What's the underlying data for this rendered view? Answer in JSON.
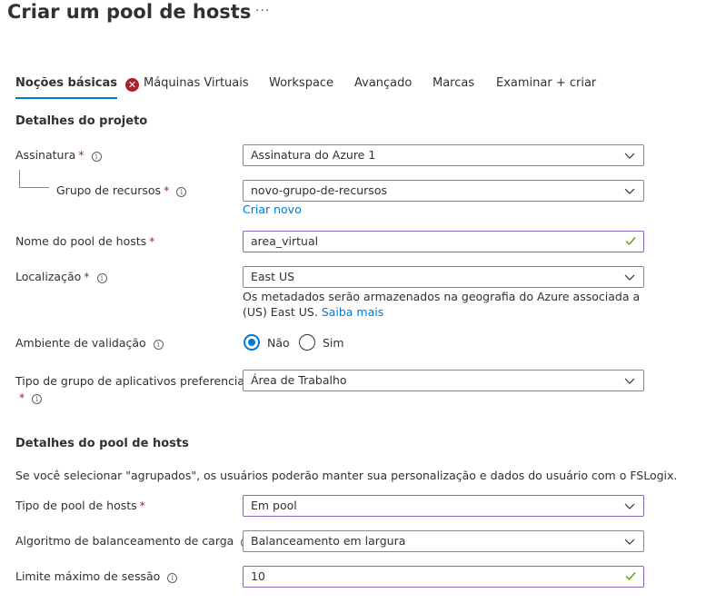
{
  "page": {
    "title": "Criar um pool de hosts",
    "more": "···"
  },
  "tabs": [
    {
      "label": "Noções básicas",
      "active": true
    },
    {
      "label": "Máquinas Virtuais",
      "error": true
    },
    {
      "label": "Workspace"
    },
    {
      "label": "Avançado"
    },
    {
      "label": "Marcas"
    },
    {
      "label": "Examinar + criar"
    }
  ],
  "project": {
    "heading": "Detalhes do projeto",
    "subscription": {
      "label": "Assinatura",
      "required": "*",
      "value": "Assinatura do Azure 1"
    },
    "resource_group": {
      "label": "Grupo de recursos",
      "required": "*",
      "value": "novo-grupo-de-recursos",
      "create_new": "Criar novo"
    },
    "pool_name": {
      "label": "Nome do pool de hosts",
      "required": "*",
      "value": "area_virtual"
    },
    "location": {
      "label": "Localização",
      "required": "*",
      "value": "East US",
      "note": "Os metadados serão armazenados na geografia do Azure associada a (US) East US.",
      "learn_more": "Saiba mais"
    },
    "validation": {
      "label": "Ambiente de validação",
      "options": [
        "Não",
        "Sim"
      ],
      "selected": "Não"
    },
    "app_group_type": {
      "label": "Tipo de grupo de aplicativos preferencial",
      "required": "*",
      "value": "Área de Trabalho"
    }
  },
  "pool": {
    "heading": "Detalhes do pool de hosts",
    "description": "Se você selecionar \"agrupados\", os usuários poderão manter sua personalização e dados do usuário com o FSLogix.",
    "pool_type": {
      "label": "Tipo de pool de hosts",
      "required": "*",
      "value": "Em pool"
    },
    "load_balancing": {
      "label": "Algoritmo de balanceamento de carga",
      "value": "Balanceamento em largura"
    },
    "max_sessions": {
      "label": "Limite máximo de sessão",
      "value": "10"
    }
  },
  "icons": {
    "info": "i",
    "error": "✕"
  },
  "colors": {
    "accent": "#0078d4",
    "error": "#a4262c",
    "valid_border": "#8764b8",
    "valid_check": "#57a300"
  }
}
